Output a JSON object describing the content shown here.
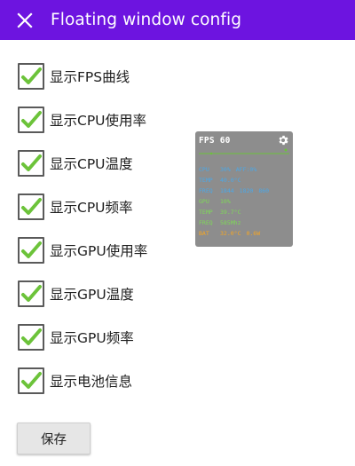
{
  "appbar": {
    "title": "Floating window config",
    "background": "#6d14e0"
  },
  "options": [
    {
      "label": "显示FPS曲线",
      "checked": true
    },
    {
      "label": "显示CPU使用率",
      "checked": true
    },
    {
      "label": "显示CPU温度",
      "checked": true
    },
    {
      "label": "显示CPU频率",
      "checked": true
    },
    {
      "label": "显示GPU使用率",
      "checked": true
    },
    {
      "label": "显示GPU温度",
      "checked": true
    },
    {
      "label": "显示GPU频率",
      "checked": true
    },
    {
      "label": "显示电池信息",
      "checked": true
    }
  ],
  "checkbox_color": "#6cc33a",
  "overlay": {
    "fps_label": "FPS",
    "fps_value": "60",
    "rows": [
      {
        "key": "CPU",
        "values": [
          "30%",
          "AFF:0%"
        ],
        "color": "#4aa8e8"
      },
      {
        "key": "TEMP",
        "values": [
          "40.0°C"
        ],
        "color": "#4aa8e8"
      },
      {
        "key": "FREQ",
        "values": [
          "1844",
          "1820",
          "860"
        ],
        "color": "#4aa8e8"
      },
      {
        "key": "GPU",
        "values": [
          "10%"
        ],
        "color": "#7ed957"
      },
      {
        "key": "TEMP",
        "values": [
          "39.7°C"
        ],
        "color": "#7ed957"
      },
      {
        "key": "FREQ",
        "values": [
          "585Mhz"
        ],
        "color": "#7ed957"
      },
      {
        "key": "BAT",
        "values": [
          "32.0°C",
          "0.6W"
        ],
        "color": "#f5a623"
      }
    ]
  },
  "save_button": {
    "label": "保存"
  }
}
